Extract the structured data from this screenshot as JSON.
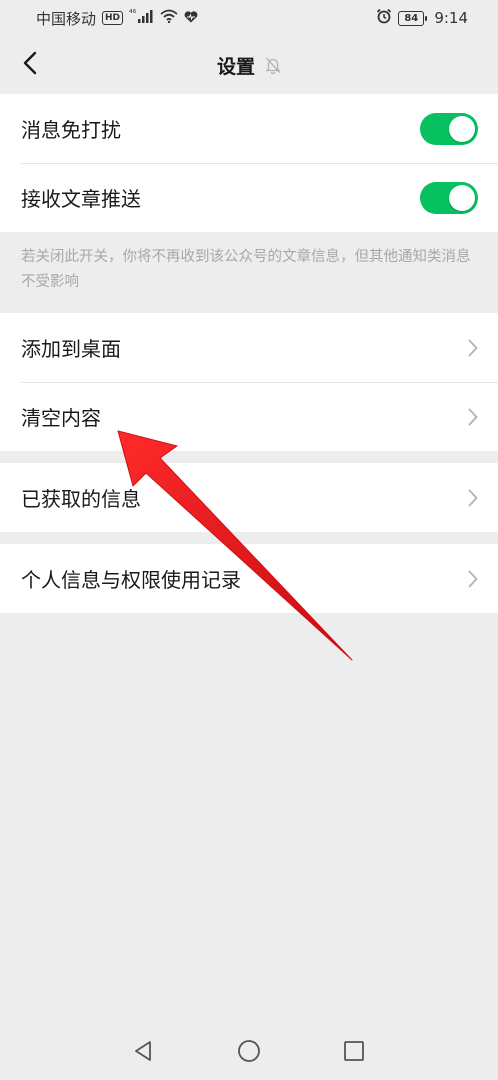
{
  "status_bar": {
    "carrier": "中国移动",
    "hd": "HD",
    "signal": "⁴⁶",
    "battery": "84",
    "time": "9:14"
  },
  "nav": {
    "title": "设置"
  },
  "group1": {
    "items": [
      {
        "label": "消息免打扰",
        "on": true
      },
      {
        "label": "接收文章推送",
        "on": true
      }
    ]
  },
  "hint": "若关闭此开关，你将不再收到该公众号的文章信息，但其他通知类消息不受影响",
  "group2": {
    "items": [
      {
        "label": "添加到桌面"
      },
      {
        "label": "清空内容"
      }
    ]
  },
  "group3": {
    "items": [
      {
        "label": "已获取的信息"
      }
    ]
  },
  "group4": {
    "items": [
      {
        "label": "个人信息与权限使用记录"
      }
    ]
  },
  "colors": {
    "accent": "#07c160",
    "background": "#ededed",
    "arrow": "#e8141b"
  },
  "icons": {
    "back": "back-arrow-icon",
    "mute": "bell-off-icon",
    "chevron": "chevron-right-icon"
  }
}
